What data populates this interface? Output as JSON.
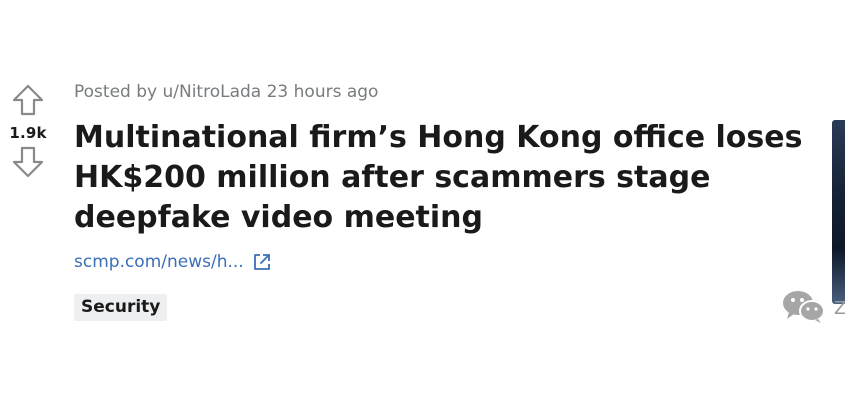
{
  "post": {
    "score": "1.9k",
    "meta": "Posted by u/NitroLada 23 hours ago",
    "title": "Multinational firm’s Hong Kong office loses HK$200 million after scammers stage deepfake video meeting",
    "link_text": "scmp.com/news/h...",
    "flair": "Security"
  },
  "watermark": {
    "text": "Z"
  },
  "icons": {
    "upvote": "arrow-up-outline-icon",
    "downvote": "arrow-down-outline-icon",
    "external_link": "external-link-icon",
    "watermark": "wechat-icon"
  },
  "colors": {
    "link": "#3b6fb6",
    "meta": "#787c7e",
    "flair_bg": "#edeff1"
  }
}
